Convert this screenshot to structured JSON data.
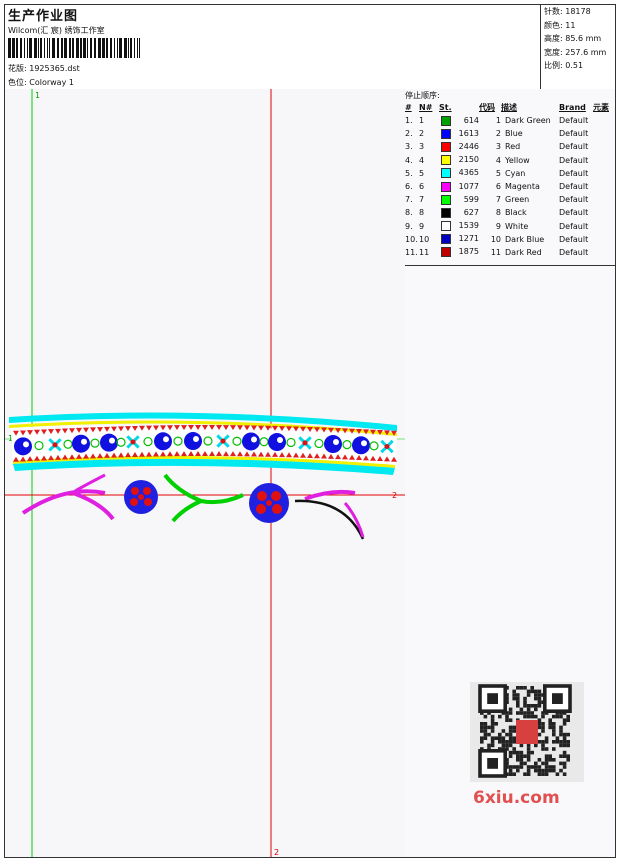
{
  "header": {
    "title": "生产作业图",
    "company": "Wilcom(汇 宸) 绣饰工作室",
    "filename_label": "花版:",
    "filename": "1925365.dst",
    "colorway_label": "色位:",
    "colorway": "Colorway 1"
  },
  "stats": [
    {
      "label": "针数:",
      "value": "18178"
    },
    {
      "label": "颜色:",
      "value": "11"
    },
    {
      "label": "高度:",
      "value": "85.6 mm"
    },
    {
      "label": "宽度:",
      "value": "257.6 mm"
    },
    {
      "label": "比例:",
      "value": "0.51"
    }
  ],
  "markers": {
    "green_top": "1",
    "green_left": "1",
    "red_right": "2",
    "red_bottom": "2"
  },
  "stop_sequence": {
    "title": "停止顺序:",
    "headers": [
      "#",
      "N#",
      "St.",
      "代码",
      "描述",
      "Brand",
      "元素"
    ],
    "rows": [
      {
        "n": "1.",
        "nn": "1",
        "color": "#00a000",
        "st": "614",
        "code": "1",
        "desc": "Dark Green",
        "brand": "Default"
      },
      {
        "n": "2.",
        "nn": "2",
        "color": "#0000ff",
        "st": "1613",
        "code": "2",
        "desc": "Blue",
        "brand": "Default"
      },
      {
        "n": "3.",
        "nn": "3",
        "color": "#ff0000",
        "st": "2446",
        "code": "3",
        "desc": "Red",
        "brand": "Default"
      },
      {
        "n": "4.",
        "nn": "4",
        "color": "#ffff00",
        "st": "2150",
        "code": "4",
        "desc": "Yellow",
        "brand": "Default"
      },
      {
        "n": "5.",
        "nn": "5",
        "color": "#00ffff",
        "st": "4365",
        "code": "5",
        "desc": "Cyan",
        "brand": "Default"
      },
      {
        "n": "6.",
        "nn": "6",
        "color": "#ff00ff",
        "st": "1077",
        "code": "6",
        "desc": "Magenta",
        "brand": "Default"
      },
      {
        "n": "7.",
        "nn": "7",
        "color": "#00ff00",
        "st": "599",
        "code": "7",
        "desc": "Green",
        "brand": "Default"
      },
      {
        "n": "8.",
        "nn": "8",
        "color": "#000000",
        "st": "627",
        "code": "8",
        "desc": "Black",
        "brand": "Default"
      },
      {
        "n": "9.",
        "nn": "9",
        "color": "#ffffff",
        "st": "1539",
        "code": "9",
        "desc": "White",
        "brand": "Default"
      },
      {
        "n": "10.",
        "nn": "10",
        "color": "#0000c0",
        "st": "1271",
        "code": "10",
        "desc": "Dark Blue",
        "brand": "Default"
      },
      {
        "n": "11.",
        "nn": "11",
        "color": "#c00000",
        "st": "1875",
        "code": "11",
        "desc": "Dark Red",
        "brand": "Default"
      }
    ]
  },
  "watermark": "6xiu.com",
  "qr_seal_text": "汇宸图"
}
